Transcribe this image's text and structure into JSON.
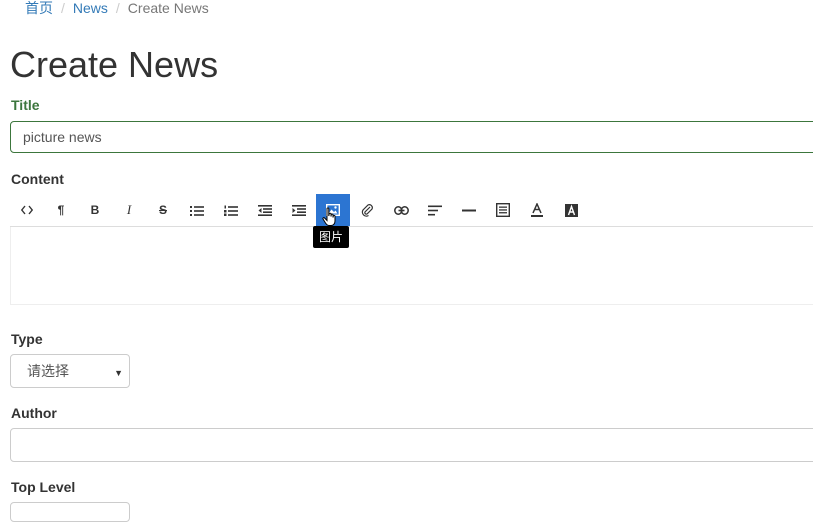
{
  "breadcrumb": {
    "home": "首页",
    "section": "News",
    "current": "Create News"
  },
  "page": {
    "title": "Create News"
  },
  "form": {
    "title_label": "Title",
    "title_value": "picture news",
    "content_label": "Content",
    "type_label": "Type",
    "type_selected": "请选择",
    "author_label": "Author",
    "author_value": "",
    "top_level_label": "Top Level"
  },
  "toolbar": {
    "items": [
      {
        "name": "html",
        "icon": "code-icon"
      },
      {
        "name": "paragraph",
        "icon": "pilcrow-icon"
      },
      {
        "name": "bold",
        "icon": "bold-icon"
      },
      {
        "name": "italic",
        "icon": "italic-icon"
      },
      {
        "name": "strikethrough",
        "icon": "strikethrough-icon"
      },
      {
        "name": "unordered-list",
        "icon": "bullet-list-icon"
      },
      {
        "name": "ordered-list",
        "icon": "numbered-list-icon"
      },
      {
        "name": "outdent",
        "icon": "outdent-icon"
      },
      {
        "name": "indent",
        "icon": "indent-icon"
      },
      {
        "name": "image",
        "icon": "image-icon",
        "active": true
      },
      {
        "name": "video",
        "icon": "paperclip-icon"
      },
      {
        "name": "link",
        "icon": "link-icon"
      },
      {
        "name": "alignment",
        "icon": "align-icon"
      },
      {
        "name": "horizontal-rule",
        "icon": "horizontal-rule-icon"
      },
      {
        "name": "table",
        "icon": "table-icon"
      },
      {
        "name": "font-color",
        "icon": "font-color-icon"
      },
      {
        "name": "background-color",
        "icon": "background-color-icon"
      }
    ],
    "tooltip": "图片"
  },
  "colors": {
    "link": "#337ab7",
    "success": "#3c763d",
    "active_tool": "#2c75d2",
    "tooltip_bg": "#000000"
  }
}
